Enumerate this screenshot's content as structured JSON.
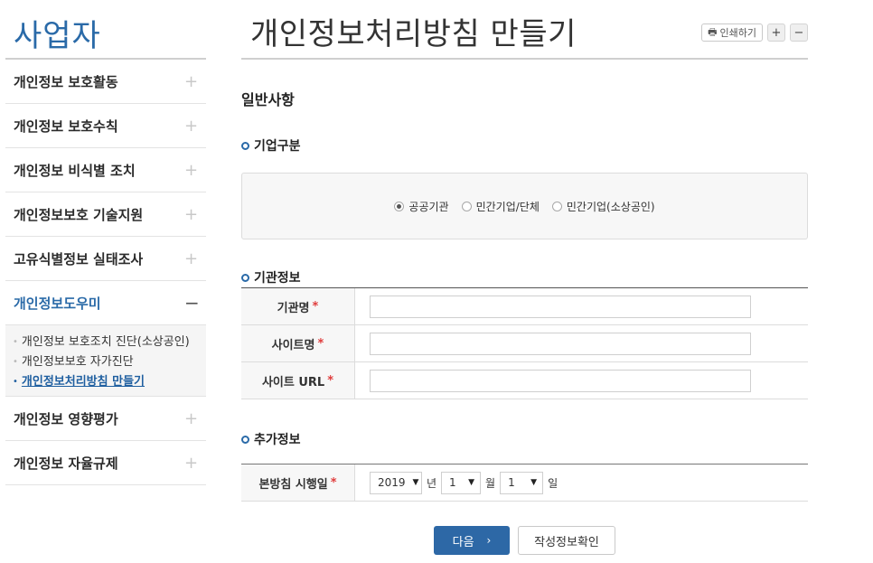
{
  "sidebar": {
    "title": "사업자",
    "items": [
      {
        "label": "개인정보 보호활동",
        "toggle": "+"
      },
      {
        "label": "개인정보 보호수칙",
        "toggle": "+"
      },
      {
        "label": "개인정보 비식별 조치",
        "toggle": "+"
      },
      {
        "label": "개인정보보호 기술지원",
        "toggle": "+"
      },
      {
        "label": "고유식별정보 실태조사",
        "toggle": "+"
      },
      {
        "label": "개인정보도우미",
        "toggle": "−"
      },
      {
        "label": "개인정보 영향평가",
        "toggle": "+"
      },
      {
        "label": "개인정보 자율규제",
        "toggle": "+"
      }
    ],
    "submenu": [
      {
        "label": "개인정보 보호조치 진단(소상공인)"
      },
      {
        "label": "개인정보보호 자가진단"
      },
      {
        "label": "개인정보처리방침 만들기"
      }
    ],
    "bullet": "•"
  },
  "header": {
    "title": "개인정보처리방침 만들기",
    "print_label": "인쇄하기",
    "print_icon": "🖶",
    "zoom_in": "+",
    "zoom_out": "−"
  },
  "main": {
    "section_title": "일반사항",
    "company_type": {
      "heading": "기업구분",
      "options": [
        {
          "label": "공공기관",
          "selected": true
        },
        {
          "label": "민간기업/단체",
          "selected": false
        },
        {
          "label": "민간기업(소상공인)",
          "selected": false
        }
      ]
    },
    "org_info": {
      "heading": "기관정보",
      "rows": [
        {
          "label": "기관명",
          "required": "*",
          "value": ""
        },
        {
          "label": "사이트명",
          "required": "*",
          "value": ""
        },
        {
          "label": "사이트 URL",
          "required": "*",
          "value": ""
        }
      ]
    },
    "extra_info": {
      "heading": "추가정보",
      "date_label": "본방침 시행일",
      "required": "*",
      "year": "2019",
      "year_unit": "년",
      "month": "1",
      "month_unit": "월",
      "day": "1",
      "day_unit": "일"
    }
  },
  "actions": {
    "next_label": "다음",
    "next_icon": "›",
    "check_label": "작성정보확인"
  },
  "colors": {
    "accent": "#2a6aa8",
    "primary_button": "#2d68a6",
    "required": "#e03c3c"
  }
}
